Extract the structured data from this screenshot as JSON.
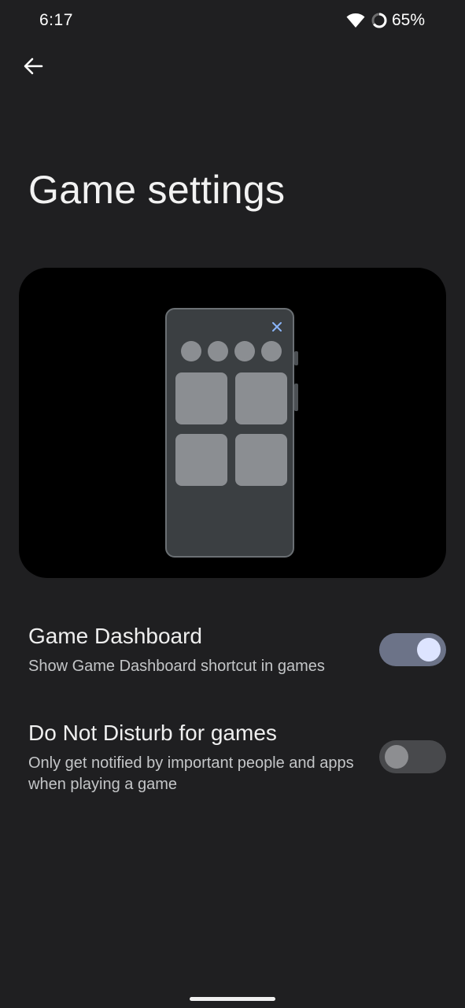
{
  "status_bar": {
    "time": "6:17",
    "battery": "65%",
    "icons": [
      "wifi-icon",
      "battery-icon"
    ]
  },
  "header": {
    "back_icon": "arrow-left-icon",
    "title": "Game settings"
  },
  "illustration": {
    "close_icon": "close-icon",
    "accent_color": "#8ab4f8"
  },
  "settings": [
    {
      "title": "Game Dashboard",
      "subtitle": "Show Game Dashboard shortcut in games",
      "enabled": true
    },
    {
      "title": "Do Not Disturb for games",
      "subtitle": "Only get notified by important people and apps when playing a game",
      "enabled": false
    }
  ],
  "colors": {
    "background": "#1f1f21",
    "toggle_on_track": "#6c7388",
    "toggle_on_knob": "#dde4ff",
    "toggle_off_track": "#48494c",
    "toggle_off_knob": "#8d8e91"
  }
}
